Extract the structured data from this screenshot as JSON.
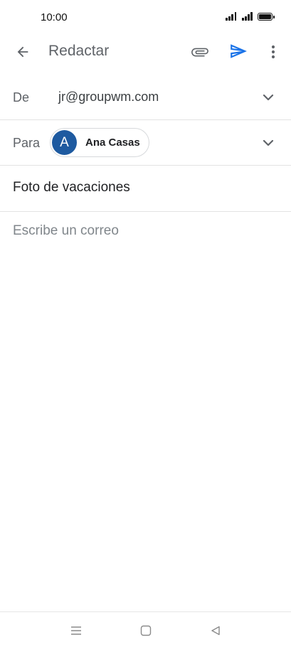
{
  "status_bar": {
    "time": "10:00",
    "icons": [
      "signal-icon",
      "signal-icon",
      "battery-icon"
    ]
  },
  "app_bar": {
    "title": "Redactar",
    "icons": {
      "back": "arrow-back-icon",
      "attach": "paperclip-icon",
      "send": "send-icon",
      "more": "more-vert-icon"
    },
    "accent_color": "#1a73e8"
  },
  "compose": {
    "from": {
      "label": "De",
      "value": "jr@groupwm.com"
    },
    "to": {
      "label": "Para",
      "recipients": [
        {
          "initial": "A",
          "name": "Ana Casas",
          "avatar_color": "#1e5aa0"
        }
      ]
    },
    "subject": {
      "value": "Foto de vacaciones"
    },
    "body": {
      "placeholder": "Escribe un correo",
      "value": ""
    }
  },
  "nav_bar": {
    "icons": [
      "menu-icon",
      "home-icon",
      "back-triangle-icon"
    ]
  }
}
